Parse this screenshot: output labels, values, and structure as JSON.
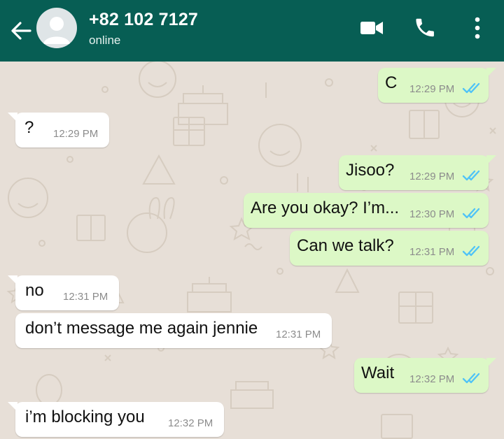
{
  "header": {
    "contact_name": "+82 102 7127",
    "status": "online",
    "colors": {
      "bar": "#075e54",
      "text": "#ffffff"
    },
    "icons": [
      "back-arrow-icon",
      "avatar-placeholder-icon",
      "video-call-icon",
      "phone-icon",
      "more-vert-icon"
    ]
  },
  "chat": {
    "colors": {
      "background": "#e7dfd7",
      "incoming": "#ffffff",
      "outgoing": "#dcf8c6",
      "read_ticks": "#4fc3f7"
    },
    "messages": [
      {
        "direction": "outgoing",
        "text": "C",
        "time": "12:29 PM",
        "status": "read"
      },
      {
        "direction": "incoming",
        "text": "?",
        "time": "12:29 PM"
      },
      {
        "direction": "outgoing",
        "text": "Jisoo?",
        "time": "12:29 PM",
        "status": "read"
      },
      {
        "direction": "outgoing",
        "text": "Are you okay? I’m...",
        "time": "12:30 PM",
        "status": "read"
      },
      {
        "direction": "outgoing",
        "text": "Can we talk?",
        "time": "12:31 PM",
        "status": "read"
      },
      {
        "direction": "incoming",
        "text": "no",
        "time": "12:31 PM"
      },
      {
        "direction": "incoming",
        "text": "don’t message me again jennie",
        "time": "12:31 PM"
      },
      {
        "direction": "outgoing",
        "text": "Wait",
        "time": "12:32 PM",
        "status": "read"
      },
      {
        "direction": "incoming",
        "text": "i’m blocking you",
        "time": "12:32 PM"
      }
    ]
  }
}
